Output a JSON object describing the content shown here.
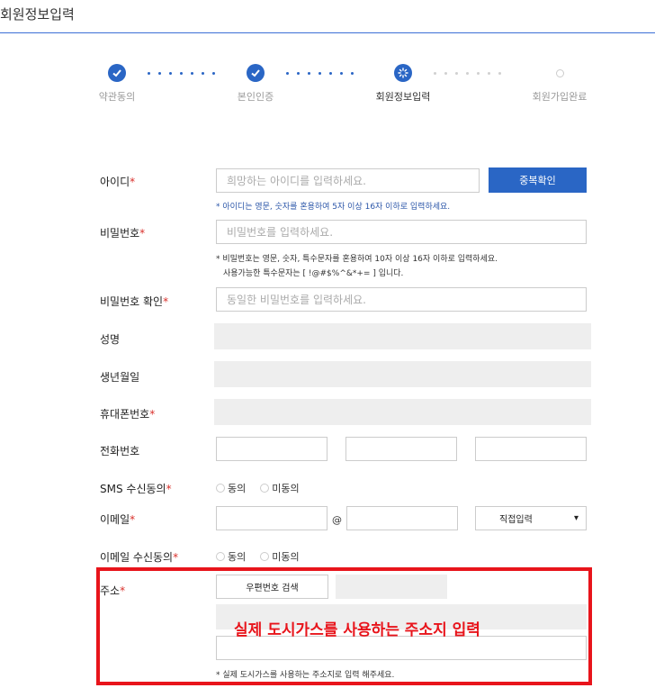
{
  "page": {
    "title": "회원정보입력"
  },
  "steps": [
    {
      "label": "약관동의",
      "state": "done"
    },
    {
      "label": "본인인증",
      "state": "done"
    },
    {
      "label": "회원정보입력",
      "state": "current"
    },
    {
      "label": "회원가입완료",
      "state": "todo"
    }
  ],
  "form": {
    "required_mark": "*",
    "id": {
      "label": "아이디",
      "placeholder": "희망하는 아이디를 입력하세요.",
      "check_button": "중복확인",
      "hint": "* 아이디는 영문, 숫자를 혼용하여 5자 이상 16자 이하로 입력하세요."
    },
    "password": {
      "label": "비밀번호",
      "placeholder": "비밀번호를 입력하세요.",
      "hint_line1": "* 비밀번호는 영문, 숫자, 특수문자를 혼용하여 10자 이상 16자 이하로 입력하세요.",
      "hint_line2": "사용가능한 특수문자는 [ !@#$%^&*+= ] 입니다."
    },
    "password_confirm": {
      "label": "비밀번호 확인",
      "placeholder": "동일한 비밀번호를 입력하세요."
    },
    "name": {
      "label": "성명"
    },
    "birth": {
      "label": "생년월일"
    },
    "mobile": {
      "label": "휴대폰번호"
    },
    "phone": {
      "label": "전화번호"
    },
    "sms": {
      "label": "SMS 수신동의",
      "agree": "동의",
      "disagree": "미동의"
    },
    "email": {
      "label": "이메일",
      "at": "@",
      "domain_select": "직접입력"
    },
    "email_consent": {
      "label": "이메일 수신동의",
      "agree": "동의",
      "disagree": "미동의"
    },
    "address": {
      "label": "주소",
      "zip_button": "우편번호 검색",
      "hint": "* 실제 도시가스를 사용하는 주소지로 입력 해주세요."
    }
  },
  "annotation": {
    "text": "실제 도시가스를 사용하는 주소지 입력",
    "color": "#e8141b"
  },
  "colors": {
    "accent": "#2a66c5",
    "required": "#d9302b"
  }
}
